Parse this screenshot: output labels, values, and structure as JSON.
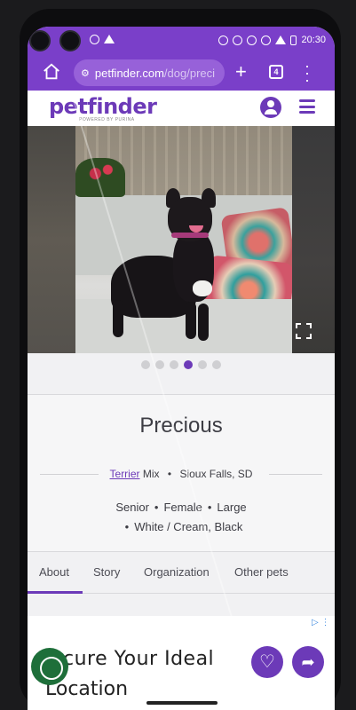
{
  "status_bar": {
    "time": "20:30"
  },
  "browser": {
    "url_host": "petfinder.com",
    "url_path": "/dog/preci",
    "tab_count": "4"
  },
  "site": {
    "logo": "petfinder",
    "logo_sub": "POWERED BY PURINA"
  },
  "carousel": {
    "total": 6,
    "active": 3
  },
  "pet": {
    "name": "Precious",
    "breed": "Terrier",
    "breed_suffix": "Mix",
    "location": "Sioux Falls, SD",
    "age": "Senior",
    "gender": "Female",
    "size": "Large",
    "color": "White / Cream, Black"
  },
  "tabs": [
    {
      "label": "About"
    },
    {
      "label": "Story"
    },
    {
      "label": "Organization"
    },
    {
      "label": "Other pets"
    }
  ],
  "ad": {
    "line1": "cure Your Ideal",
    "line2": "Location"
  },
  "colors": {
    "brand": "#6c3ab8",
    "chrome": "#7a3fc9"
  }
}
